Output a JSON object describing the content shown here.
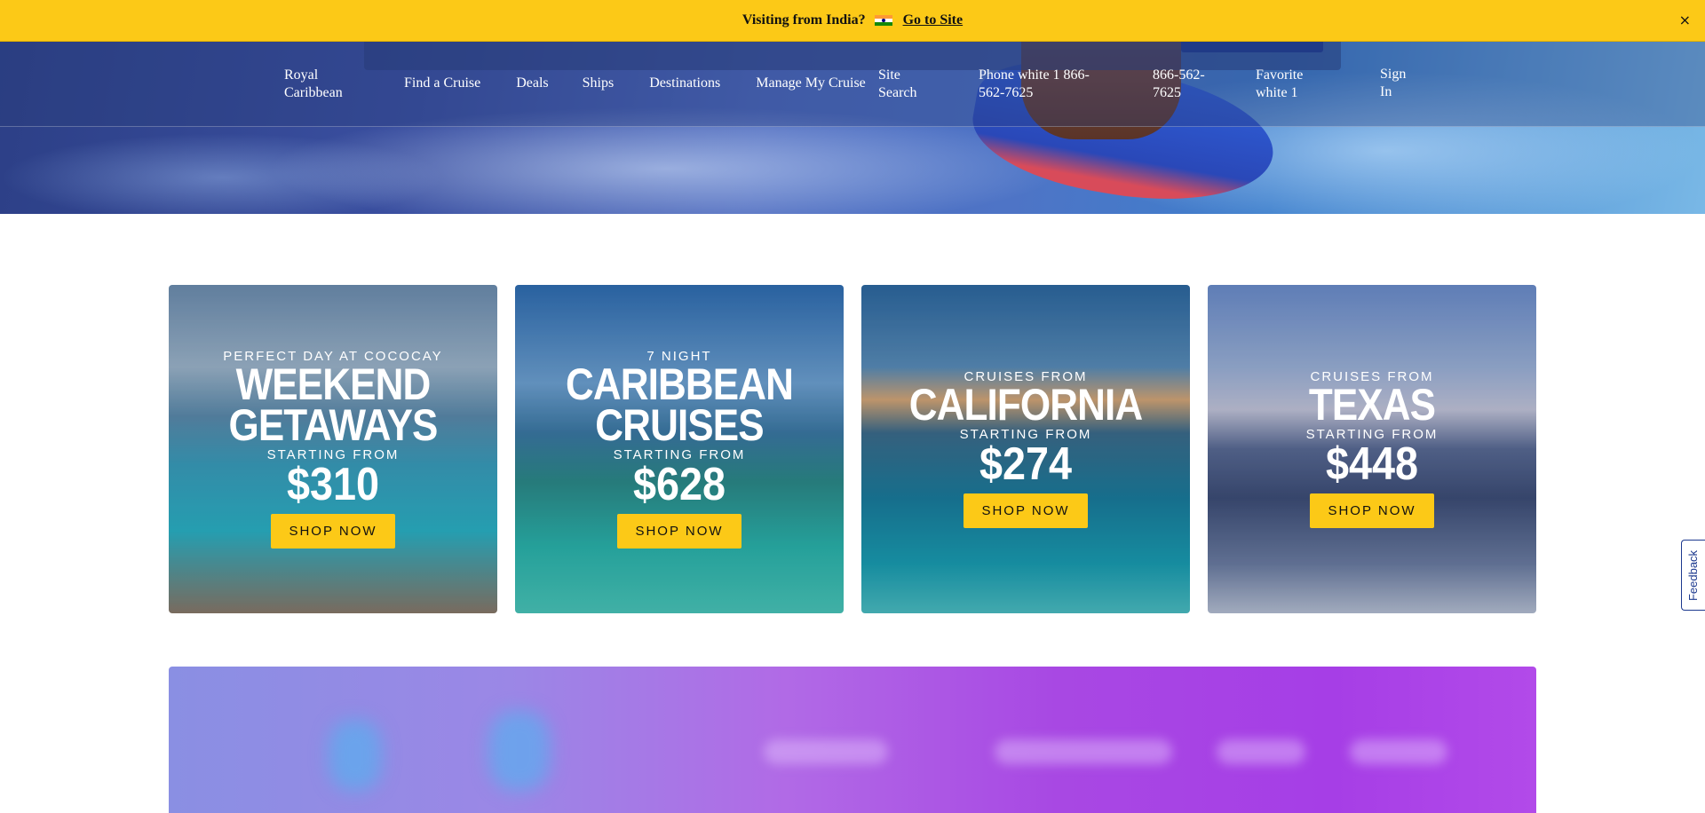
{
  "banner": {
    "message": "Visiting from India?",
    "link": "Go to Site",
    "close": "×"
  },
  "header": {
    "logo_alt": "Royal Caribbean",
    "nav": [
      "Find a Cruise",
      "Deals",
      "Ships",
      "Destinations",
      "Manage My Cruise"
    ],
    "search_alt": "Site Search",
    "phone_alt": "Phone white 1 866-562-7625",
    "phone_number": "866-562-7625",
    "favorite_alt": "Favorite white 1",
    "sign_in": "Sign In"
  },
  "cards": [
    {
      "pre": "PERFECT DAY AT COCOCAY",
      "title_line1": "WEEKEND",
      "title_line2": "GETAWAYS",
      "starting": "STARTING FROM",
      "price": "$310",
      "cta": "SHOP NOW"
    },
    {
      "pre": "7 NIGHT",
      "title_line1": "CARIBBEAN",
      "title_line2": "CRUISES",
      "starting": "STARTING FROM",
      "price": "$628",
      "cta": "SHOP NOW"
    },
    {
      "pre": "CRUISES FROM",
      "title_line1": "CALIFORNIA",
      "starting": "STARTING FROM",
      "price": "$274",
      "cta": "SHOP NOW"
    },
    {
      "pre": "CRUISES FROM",
      "title_line1": "TEXAS",
      "starting": "STARTING FROM",
      "price": "$448",
      "cta": "SHOP NOW"
    }
  ],
  "feedback": "Feedback",
  "colors": {
    "banner": "#fcc917",
    "cta": "#fcc917",
    "brand_blue": "#1d3a8f"
  }
}
